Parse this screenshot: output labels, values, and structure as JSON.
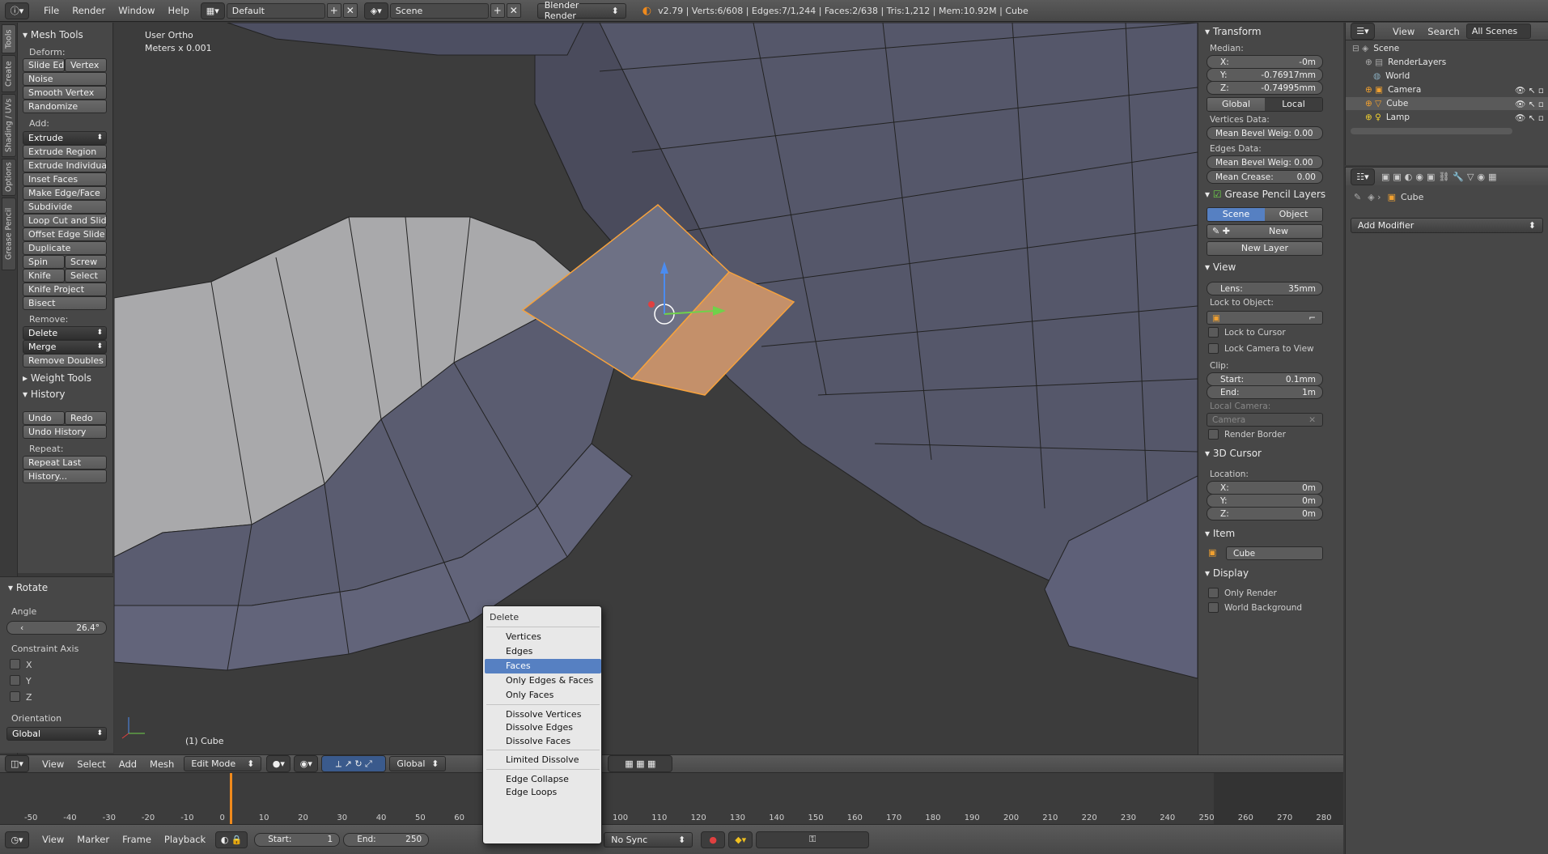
{
  "topbar": {
    "menus": [
      "File",
      "Render",
      "Window",
      "Help"
    ],
    "layout": "Default",
    "scene": "Scene",
    "engine": "Blender Render",
    "stats": "v2.79 | Verts:6/608 | Edges:7/1,244 | Faces:2/638 | Tris:1,212 | Mem:10.92M | Cube"
  },
  "left_tabs": [
    "Tools",
    "Create",
    "Shading / UVs",
    "Options",
    "Grease Pencil"
  ],
  "toolshelf": {
    "mesh_tools": "Mesh Tools",
    "deform_label": "Deform:",
    "slide_edge": "Slide Ed",
    "vertex": "Vertex",
    "noise": "Noise",
    "smooth_vertex": "Smooth Vertex",
    "randomize": "Randomize",
    "add_label": "Add:",
    "extrude": "Extrude",
    "extrude_region": "Extrude Region",
    "extrude_individual": "Extrude Individual",
    "inset_faces": "Inset Faces",
    "make_edge_face": "Make Edge/Face",
    "subdivide": "Subdivide",
    "loop_cut": "Loop Cut and Slide",
    "offset_edge": "Offset Edge Slide",
    "duplicate": "Duplicate",
    "spin": "Spin",
    "screw": "Screw",
    "knife": "Knife",
    "select": "Select",
    "knife_project": "Knife Project",
    "bisect": "Bisect",
    "remove_label": "Remove:",
    "delete": "Delete",
    "merge": "Merge",
    "remove_doubles": "Remove Doubles",
    "weight_tools": "Weight Tools",
    "history": "History",
    "undo": "Undo",
    "redo": "Redo",
    "undo_history": "Undo History",
    "repeat_label": "Repeat:",
    "repeat_last": "Repeat Last",
    "history_dots": "History..."
  },
  "operator": {
    "title": "Rotate",
    "angle_label": "Angle",
    "angle_value": "26.4°",
    "constraint_label": "Constraint Axis",
    "axes": [
      "X",
      "Y",
      "Z"
    ],
    "orientation_label": "Orientation",
    "orientation_value": "Global"
  },
  "viewport": {
    "view_name": "User Ortho",
    "units": "Meters x 0.001",
    "object_label": "(1) Cube"
  },
  "v3d_header": {
    "menus": [
      "View",
      "Select",
      "Add",
      "Mesh"
    ],
    "mode": "Edit Mode",
    "orientation": "Global"
  },
  "timeline": {
    "ticks": [
      "-50",
      "-40",
      "-30",
      "-20",
      "-10",
      "0",
      "10",
      "20",
      "30",
      "40",
      "50",
      "60",
      "100",
      "110",
      "120",
      "130",
      "140",
      "150",
      "160",
      "170",
      "180",
      "190",
      "200",
      "210",
      "220",
      "230",
      "240",
      "250",
      "260",
      "270",
      "280"
    ],
    "current_frame": 0,
    "menus": [
      "View",
      "Marker",
      "Frame",
      "Playback"
    ],
    "start_label": "Start:",
    "start_value": "1",
    "end_label": "End:",
    "end_value": "250",
    "sync": "No Sync"
  },
  "npanel": {
    "transform": "Transform",
    "median": "Median:",
    "x_label": "X:",
    "x_value": "-0m",
    "y_label": "Y:",
    "y_value": "-0.76917mm",
    "z_label": "Z:",
    "z_value": "-0.74995mm",
    "global": "Global",
    "local": "Local",
    "vertices_data": "Vertices Data:",
    "mean_bevel_weight_v": "Mean Bevel Weig: 0.00",
    "edges_data": "Edges Data:",
    "mean_bevel_weight_e": "Mean Bevel Weig: 0.00",
    "mean_crease": "Mean Crease:",
    "mean_crease_value": "0.00",
    "grease_pencil": "Grease Pencil Layers",
    "gp_scene": "Scene",
    "gp_object": "Object",
    "gp_new": "New",
    "gp_new_layer": "New Layer",
    "view": "View",
    "lens_label": "Lens:",
    "lens_value": "35mm",
    "lock_to_object": "Lock to Object:",
    "lock_to_cursor": "Lock to Cursor",
    "lock_camera": "Lock Camera to View",
    "clip": "Clip:",
    "clip_start_label": "Start:",
    "clip_start_value": "0.1mm",
    "clip_end_label": "End:",
    "clip_end_value": "1m",
    "local_camera": "Local Camera:",
    "camera": "Camera",
    "render_border": "Render Border",
    "cursor_3d": "3D Cursor",
    "location": "Location:",
    "cx_label": "X:",
    "cx_value": "0m",
    "cy_label": "Y:",
    "cy_value": "0m",
    "cz_label": "Z:",
    "cz_value": "0m",
    "item": "Item",
    "item_name": "Cube",
    "display": "Display",
    "only_render": "Only Render",
    "world_background": "World Background"
  },
  "outliner": {
    "menus": [
      "View",
      "Search"
    ],
    "filter": "All Scenes",
    "rows": [
      "Scene",
      "RenderLayers",
      "World",
      "Camera",
      "Cube",
      "Lamp"
    ]
  },
  "properties": {
    "object_name": "Cube",
    "add_modifier": "Add Modifier"
  },
  "delete_menu": {
    "title": "Delete",
    "vertices": "Vertices",
    "edges": "Edges",
    "faces": "Faces",
    "only_edges_faces": "Only Edges & Faces",
    "only_faces": "Only Faces",
    "dissolve_vertices": "Dissolve Vertices",
    "dissolve_edges": "Dissolve Edges",
    "dissolve_faces": "Dissolve Faces",
    "limited_dissolve": "Limited Dissolve",
    "edge_collapse": "Edge Collapse",
    "edge_loops": "Edge Loops",
    "selected": "Faces"
  },
  "colors": {
    "selection": "#5680c2",
    "face_select": "#d49a6a",
    "accent_orange": "#ffa030"
  }
}
